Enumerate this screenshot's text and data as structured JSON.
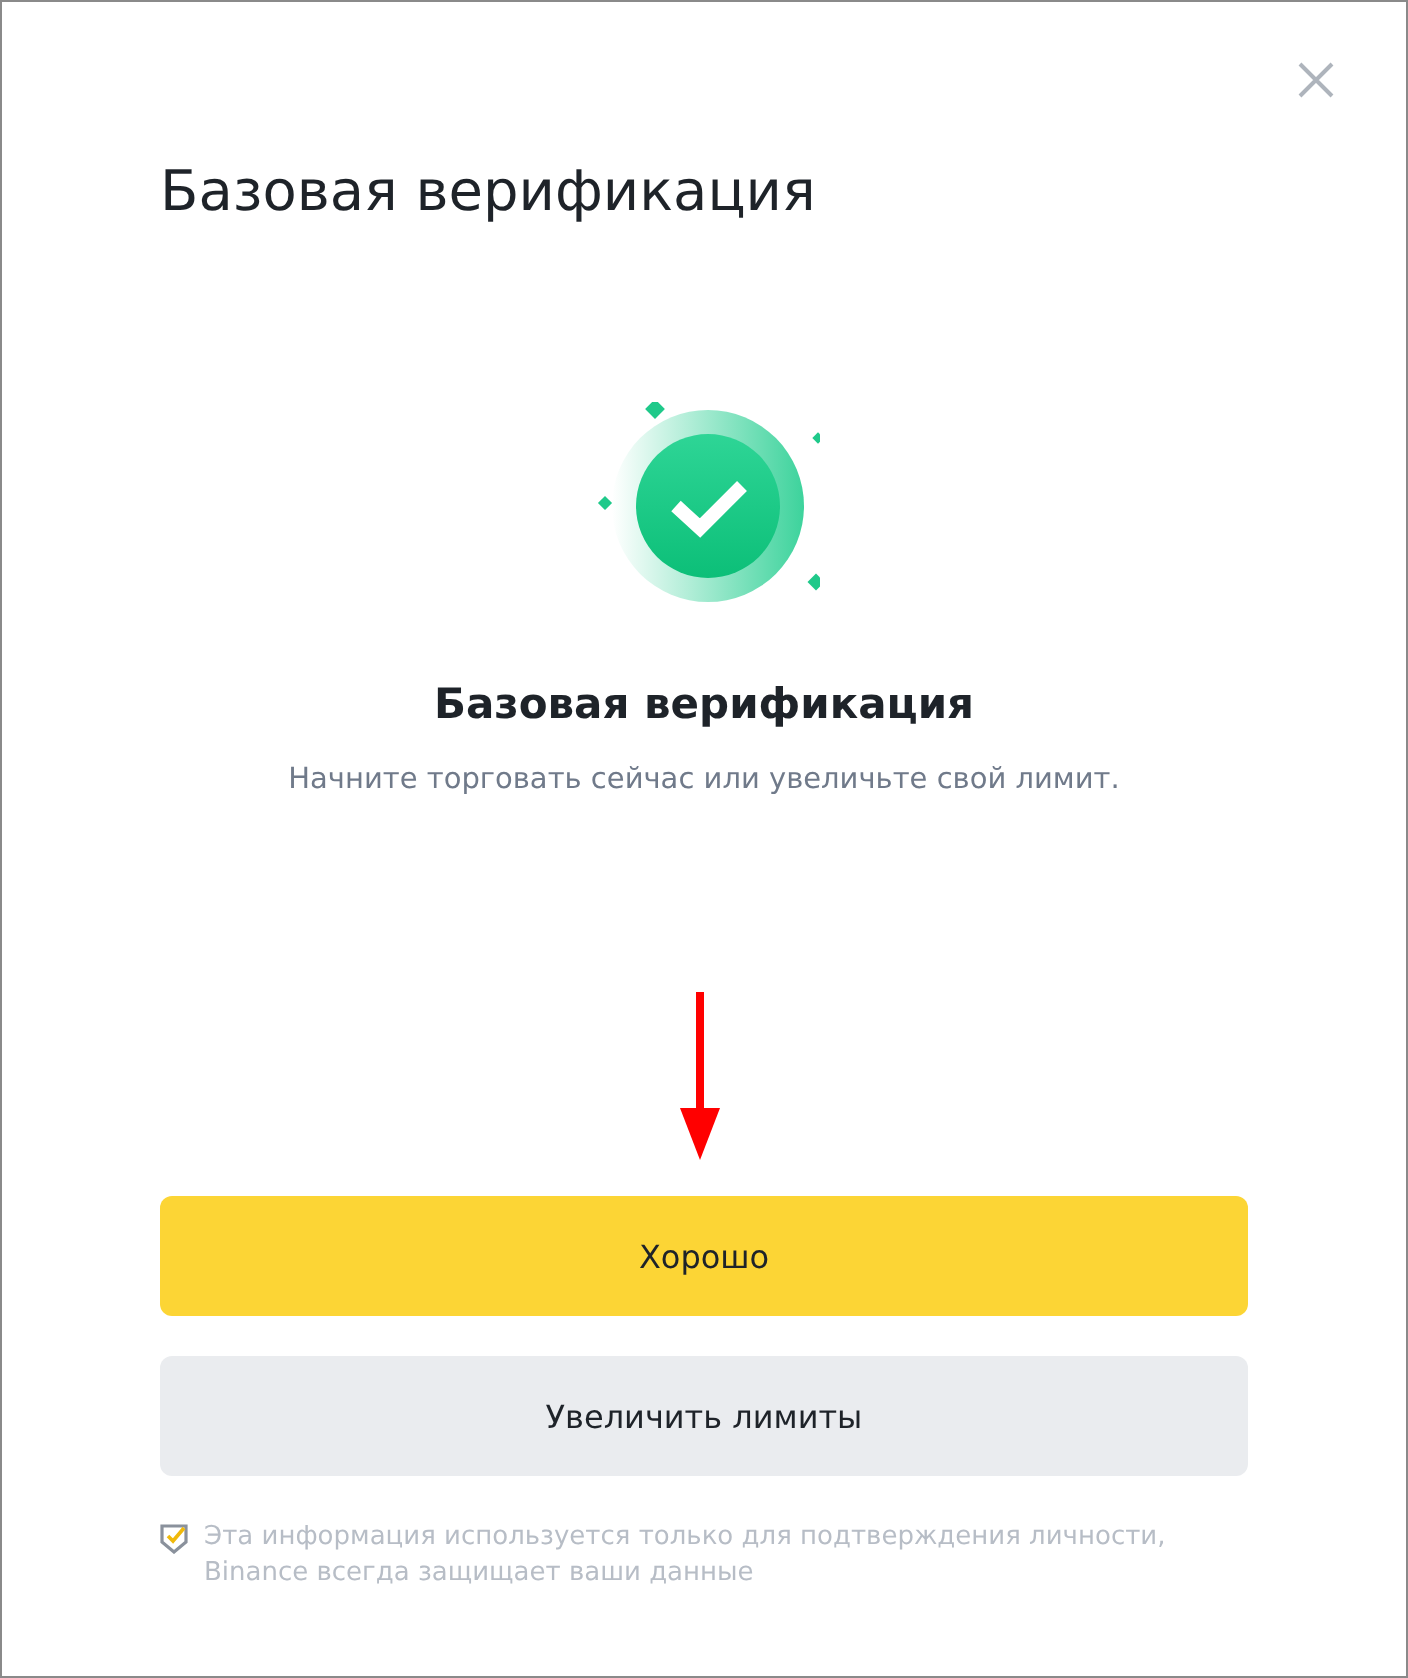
{
  "dialog": {
    "title": "Базовая верификация"
  },
  "status": {
    "heading": "Базовая верификация",
    "text": "Начните торговать сейчас или увеличьте свой лимит."
  },
  "buttons": [
    {
      "label": "Хорошо",
      "kind": "primary"
    },
    {
      "label": "Увеличить лимиты",
      "kind": "secondary"
    }
  ],
  "footer": {
    "text": "Эта информация используется только для подтверждения личности, Binance всегда защищает ваши данные"
  }
}
